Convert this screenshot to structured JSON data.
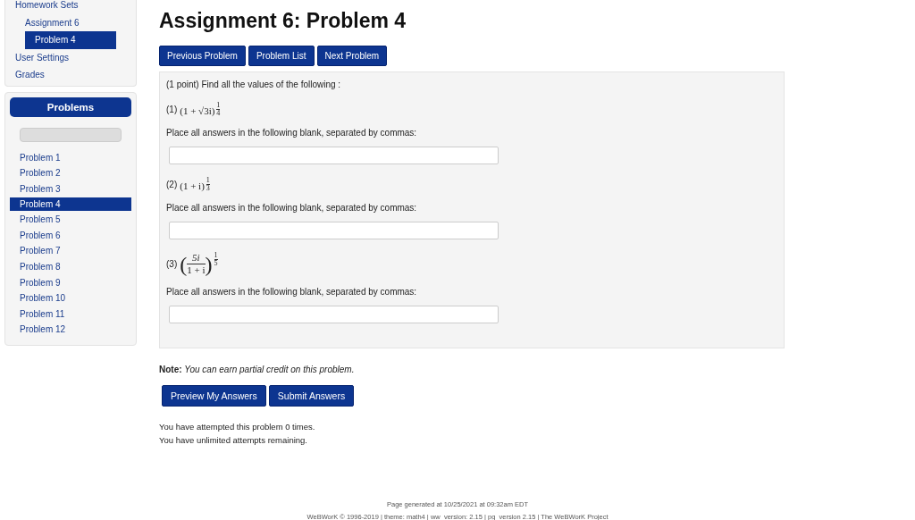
{
  "nav": {
    "items": [
      {
        "label": "Homework Sets",
        "kind": "top",
        "selected": false
      },
      {
        "label": "Assignment 6",
        "kind": "sub",
        "selected": false
      },
      {
        "label": "Problem 4",
        "kind": "subsub",
        "selected": true
      },
      {
        "label": "User Settings",
        "kind": "top",
        "selected": false
      },
      {
        "label": "Grades",
        "kind": "top",
        "selected": false
      }
    ]
  },
  "problems_panel": {
    "title": "Problems",
    "progress": {
      "level": 0
    },
    "items": [
      {
        "label": "Problem 1",
        "selected": false
      },
      {
        "label": "Problem 2",
        "selected": false
      },
      {
        "label": "Problem 3",
        "selected": false
      },
      {
        "label": "Problem 4",
        "selected": true
      },
      {
        "label": "Problem 5",
        "selected": false
      },
      {
        "label": "Problem 6",
        "selected": false
      },
      {
        "label": "Problem 7",
        "selected": false
      },
      {
        "label": "Problem 8",
        "selected": false
      },
      {
        "label": "Problem 9",
        "selected": false
      },
      {
        "label": "Problem 10",
        "selected": false
      },
      {
        "label": "Problem 11",
        "selected": false
      },
      {
        "label": "Problem 12",
        "selected": false
      }
    ]
  },
  "page_title": "Assignment 6: Problem 4",
  "nav_buttons": [
    "Previous Problem",
    "Problem List",
    "Next Problem"
  ],
  "problem": {
    "intro": "(1 point) Find all the values of the following :",
    "parts": [
      {
        "label": "(1)",
        "expr": "(1 + √3i)",
        "exp_num": "1",
        "exp_den": "4",
        "kind": "plain",
        "instruction": "Place all answers in the following blank, separated by commas:"
      },
      {
        "label": "(2)",
        "expr": "(1 + i)",
        "exp_num": "1",
        "exp_den": "3",
        "kind": "plain",
        "instruction": "Place all answers in the following blank, separated by commas:"
      },
      {
        "label": "(3)",
        "open": "(",
        "close": ")",
        "num": "5i",
        "den": "1 + i",
        "exp_num": "1",
        "exp_den": "5",
        "kind": "fraction",
        "instruction": "Place all answers in the following blank, separated by commas:"
      }
    ]
  },
  "note": {
    "label": "Note:",
    "text": "You can earn partial credit on this problem."
  },
  "action_buttons": [
    "Preview My Answers",
    "Submit Answers"
  ],
  "attempts": [
    "You have attempted this problem 0 times.",
    "You have unlimited attempts remaining."
  ],
  "footer": [
    "Page generated at 10/25/2021 at 09:32am EDT",
    "WeBWorK © 1996-2019 | theme: math4 | ww_version: 2.15 | pg_version 2.15 | The WeBWorK Project"
  ]
}
